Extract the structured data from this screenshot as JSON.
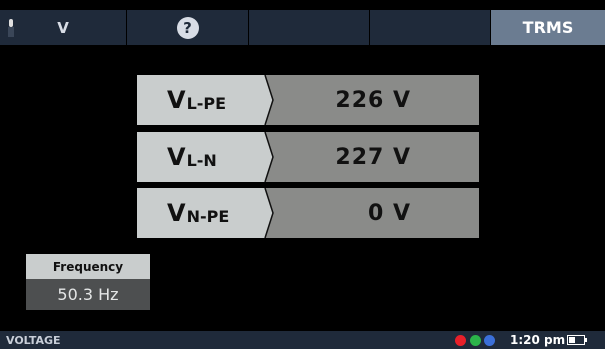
{
  "tabs": [
    {
      "label": "V"
    },
    {
      "label": "?"
    },
    {
      "label": ""
    },
    {
      "label": ""
    },
    {
      "label": "TRMS"
    }
  ],
  "measurements": [
    {
      "main": "V",
      "sub": "L-PE",
      "value": "226 V"
    },
    {
      "main": "V",
      "sub": "L-N",
      "value": "227 V"
    },
    {
      "main": "V",
      "sub": "N-PE",
      "value": "0 V"
    }
  ],
  "frequency": {
    "label": "Frequency",
    "value": "50.3 Hz"
  },
  "status": {
    "mode": "VOLTAGE",
    "time": "1:20 pm",
    "dot_colors": [
      "#e8202a",
      "#2bb34a",
      "#3b6fd8"
    ]
  },
  "colors": {
    "tab_bg": "#1f2a3a",
    "tab_active_bg": "#6b7c91",
    "label_bg": "#c9cdcd",
    "value_bg": "#8a8b89"
  }
}
